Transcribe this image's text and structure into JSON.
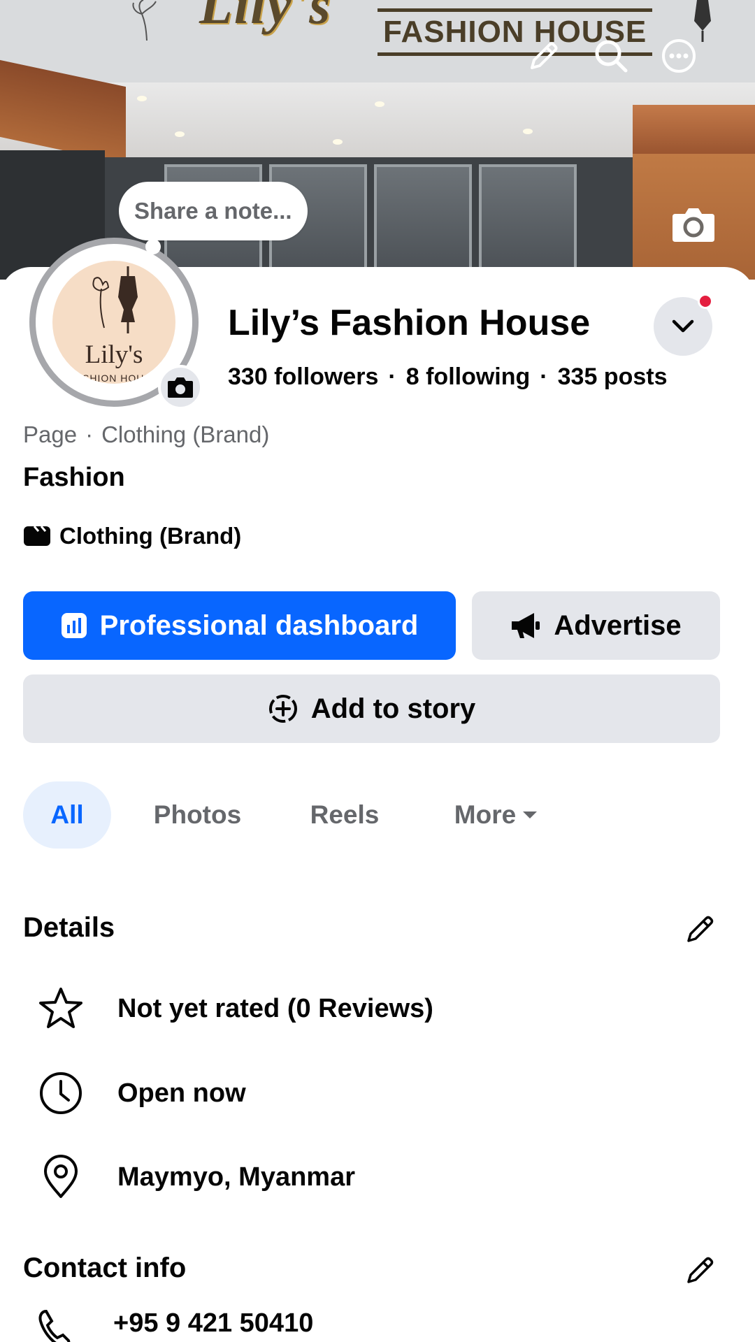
{
  "cover": {
    "sign_brand": "Lily's",
    "sign_subtitle": "FASHION HOUSE"
  },
  "note": {
    "placeholder": "Share a note..."
  },
  "profile": {
    "name": "Lily’s Fashion House",
    "avatar_text": "Lily's",
    "avatar_subtext": "FASHION HOUSE",
    "followers": "330 followers",
    "following": "8 following",
    "posts": "335 posts",
    "separator": "·",
    "page_type": "Page",
    "category": "Clothing (Brand)",
    "bio": "Fashion",
    "brand_label": "Clothing (Brand)"
  },
  "actions": {
    "dashboard_label": "Professional dashboard",
    "advertise_label": "Advertise",
    "story_label": "Add to story"
  },
  "tabs": [
    {
      "label": "All",
      "active": true
    },
    {
      "label": "Photos",
      "active": false
    },
    {
      "label": "Reels",
      "active": false
    },
    {
      "label": "More",
      "active": false
    }
  ],
  "details": {
    "heading": "Details",
    "items": [
      {
        "icon": "star-icon",
        "text": "Not yet rated (0 Reviews)"
      },
      {
        "icon": "clock-icon",
        "text": "Open now"
      },
      {
        "icon": "location-pin-icon",
        "text": "Maymyo, Myanmar"
      }
    ]
  },
  "contact": {
    "heading": "Contact info",
    "phone": "+95 9 421 50410"
  },
  "colors": {
    "primary": "#0866ff",
    "button_gray": "#e4e6eb",
    "secondary_text": "#65676b",
    "notification_dot": "#e41e3f"
  }
}
